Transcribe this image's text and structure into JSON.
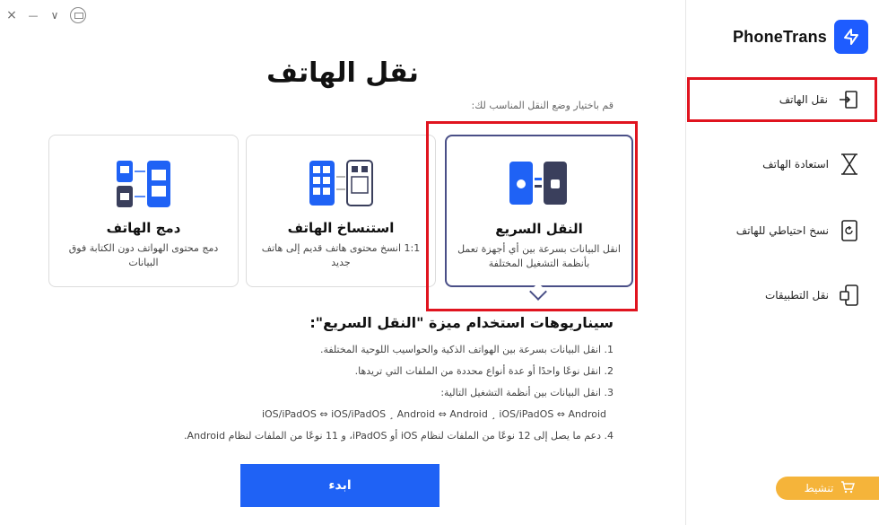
{
  "window": {
    "close": "×",
    "minimize": "—",
    "dropdown": "∨"
  },
  "brand": {
    "name": "PhoneTrans"
  },
  "sidebar": {
    "items": [
      {
        "label": "نقل الهاتف",
        "icon": "transfer-icon"
      },
      {
        "label": "استعادة الهاتف",
        "icon": "hourglass-icon"
      },
      {
        "label": "نسخ احتياطي للهاتف",
        "icon": "backup-icon"
      },
      {
        "label": "نقل التطبيقات",
        "icon": "apps-icon"
      }
    ],
    "activate": "تنشيط"
  },
  "main": {
    "title": "نقل الهاتف",
    "subtitle": "قم باختيار وضع النقل المناسب لك:",
    "cards": [
      {
        "title": "دمج الهاتف",
        "desc": "دمج محتوى الهواتف دون الكتابة فوق البيانات"
      },
      {
        "title": "استنساخ الهاتف",
        "desc": "1:1 انسخ محتوى هاتف قديم إلى هاتف جديد"
      },
      {
        "title": "النقل السريع",
        "desc": "انقل البيانات بسرعة بين أي أجهزة تعمل بأنظمة التشغيل المختلفة"
      }
    ],
    "scenarios": {
      "heading": "سيناريوهات استخدام ميزة \"النقل السريع\":",
      "items": [
        "1. انقل البيانات بسرعة بين الهواتف الذكية والحواسيب اللوحية المختلفة.",
        "2. انقل نوعًا واحدًا أو عدة أنواع محددة من الملفات التي تريدها.",
        "3. انقل البيانات بين أنظمة التشغيل التالية:",
        "iOS/iPadOS ⇔ iOS/iPadOS ¸ Android ⇔ Android ¸ iOS/iPadOS ⇔ Android",
        "4. دعم ما يصل إلى 12 نوعًا من الملفات لنظام iOS أو iPadOS، و 11 نوعًا من الملفات لنظام Android."
      ]
    },
    "start_label": "ابدء"
  }
}
